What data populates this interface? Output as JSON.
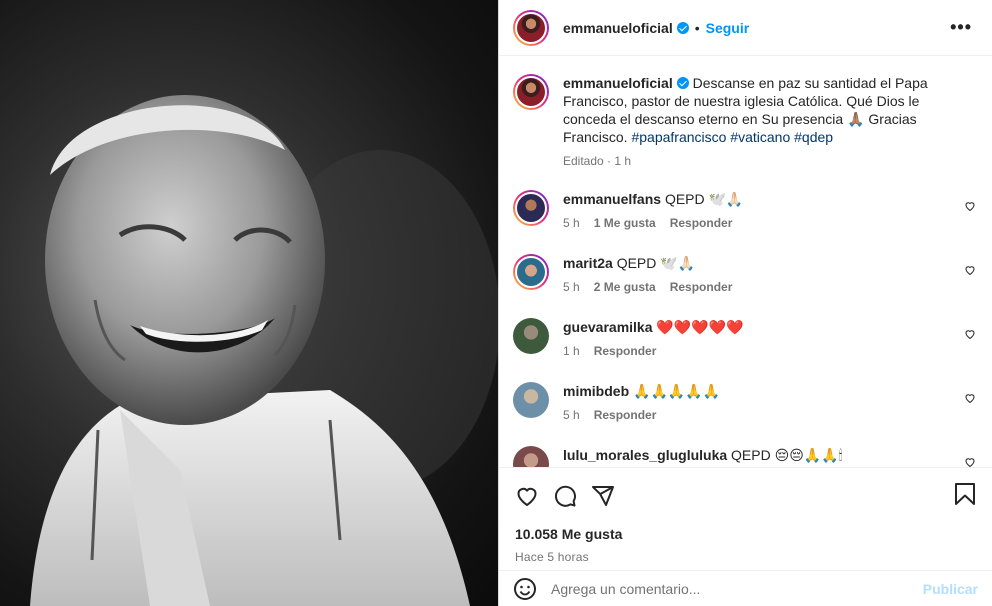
{
  "post": {
    "username": "emmanueloficial",
    "follow_label": "Seguir",
    "caption_text": "Descanse en paz su santidad el Papa Francisco, pastor de nuestra iglesia Católica. Qué Dios le conceda el descanso eterno en Su presencia 🙏🏽 Gracias Francisco.",
    "hashtags": "#papafrancisco #vaticano #qdep",
    "caption_meta": "Editado · 1 h",
    "likes": "10.058 Me gusta",
    "time_ago": "Hace 5 horas"
  },
  "comments": [
    {
      "user": "emmanuelfans",
      "text": "QEPD 🕊️🙏🏻",
      "time": "5 h",
      "likes": "1 Me gusta",
      "reply": "Responder"
    },
    {
      "user": "marit2a",
      "text": "QEPD 🕊️🙏🏻",
      "time": "5 h",
      "likes": "2 Me gusta",
      "reply": "Responder"
    },
    {
      "user": "guevaramilka",
      "text": "❤️❤️❤️❤️❤️",
      "time": "1 h",
      "likes": "",
      "reply": "Responder"
    },
    {
      "user": "mimibdeb",
      "text": "🙏🙏🙏🙏🙏",
      "time": "5 h",
      "likes": "",
      "reply": "Responder"
    },
    {
      "user": "lulu_morales_glugluluka",
      "text": "QEPD 😔😔🙏🙏🕯",
      "time": "",
      "likes": "",
      "reply": ""
    }
  ],
  "add_comment": {
    "placeholder": "Agrega un comentario...",
    "publish_label": "Publicar"
  },
  "icons": {
    "like": "heart-icon",
    "comment": "comment-icon",
    "share": "share-icon",
    "save": "bookmark-icon",
    "more": "more-icon",
    "emoji": "emoji-icon"
  },
  "colors": {
    "accent": "#0095f6",
    "link": "#00376b",
    "muted": "#737373",
    "publish_disabled": "#b2dffc"
  }
}
